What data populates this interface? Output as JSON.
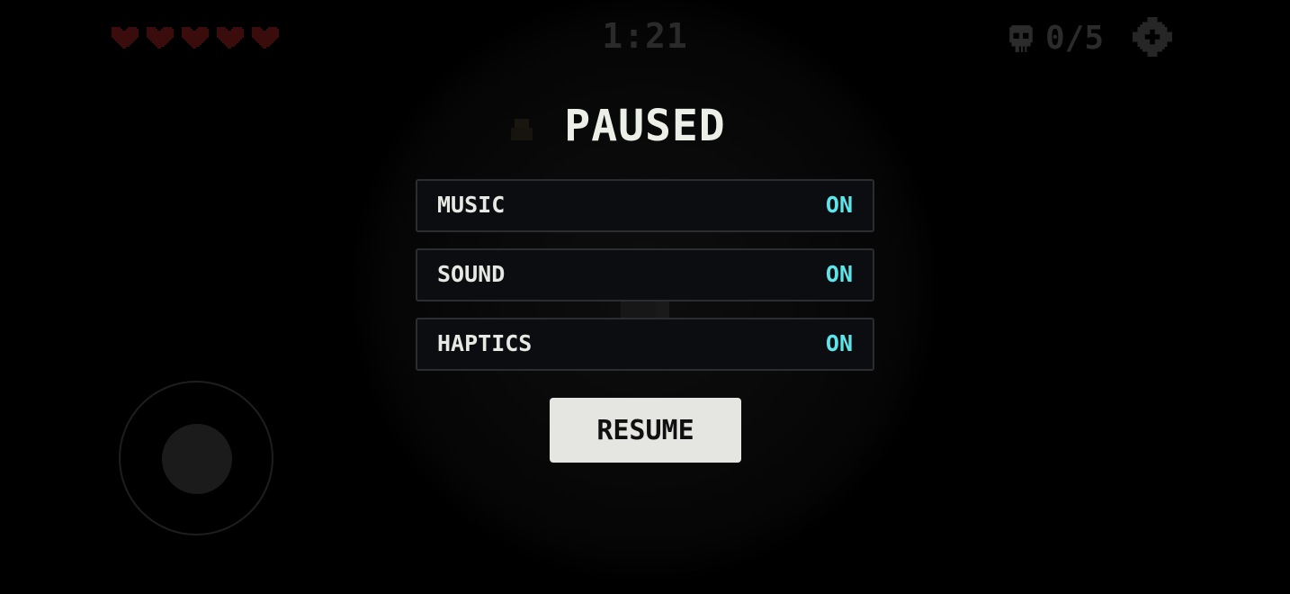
{
  "hud": {
    "hearts": {
      "count": 5,
      "filled": 5,
      "color": "#3a0c0c"
    },
    "timer": "1:21",
    "kills": {
      "text": "0/5",
      "icon": "skull-icon"
    },
    "settings_icon": "gear-icon"
  },
  "pause_menu": {
    "title": "PAUSED",
    "options": [
      {
        "label": "MUSIC",
        "value": "ON"
      },
      {
        "label": "SOUND",
        "value": "ON"
      },
      {
        "label": "HAPTICS",
        "value": "ON"
      }
    ],
    "resume_label": "RESUME",
    "accent_color": "#5ce6ea"
  },
  "joystick": {
    "icon": "joystick-icon"
  }
}
